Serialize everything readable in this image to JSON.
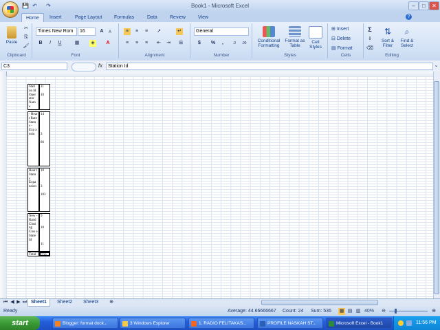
{
  "window": {
    "title": "Book1 - Microsoft Excel",
    "controls": {
      "minimize": "–",
      "maximize": "□",
      "close": "✕"
    },
    "qat": {
      "save": "💾",
      "undo": "↶",
      "redo": "↷"
    }
  },
  "ribbon_tabs": [
    "Home",
    "Insert",
    "Page Layout",
    "Formulas",
    "Data",
    "Review",
    "View"
  ],
  "ribbon": {
    "clipboard": {
      "paste": "Paste",
      "label": "Clipboard"
    },
    "font": {
      "name": "Times New Rom",
      "size": "16",
      "label": "Font",
      "bold": "B",
      "italic": "I",
      "underline": "U",
      "grow": "A",
      "shrink": "A"
    },
    "alignment": {
      "label": "Alignment"
    },
    "number": {
      "format": "General",
      "label": "Number",
      "currency": "$",
      "percent": "%",
      "comma": ","
    },
    "styles": {
      "conditional": "Conditional Formatting",
      "table": "Format as Table",
      "cell": "Cell Styles",
      "label": "Styles"
    },
    "cells": {
      "insert": "Insert",
      "delete": "Delete",
      "format": "Format",
      "label": "Cells"
    },
    "editing": {
      "sum": "Σ",
      "sort": "Sort & Filter",
      "find": "Find & Select",
      "label": "Editing"
    }
  },
  "formula_bar": {
    "name_box": "C3",
    "fx": "fx",
    "content": "Station Id"
  },
  "cells": [
    {
      "text": "Stati on Id Oper ator Nam e",
      "num": "11\n\n10"
    },
    {
      "text": "- Hear t Rate Statu s - Exp a nsio",
      "num": "14\n\n\n\n\n3\n\n86"
    },
    {
      "text": "Hear t Statu s Expa nsion",
      "num": "10\n\n\n\n3\n\n103"
    },
    {
      "text": "New - Rand Closi ng Clos e State Id",
      "num": "9\n\n\n10\n\n\n\n11"
    },
    {
      "text": "Total",
      "num": "536"
    }
  ],
  "sheet_tabs": [
    "Sheet1",
    "Sheet2",
    "Sheet3"
  ],
  "status": {
    "ready": "Ready",
    "average": "Average: 44.66666667",
    "count": "Count: 24",
    "sum": "Sum: 536",
    "zoom": "40%"
  },
  "taskbar": {
    "start": "start",
    "tasks": [
      "Blogger: format dock...",
      "3 Windows Explorer",
      "1. RADIO FELITAKAS...",
      "PROFILE NASKAH ST...",
      "Microsoft Excel - Book1"
    ],
    "clock": "11:56 PM"
  },
  "colors": {
    "ribbon": "#d3e2f5",
    "accent": "#15428b",
    "taskbar": "#245edb",
    "start": "#3a9a35"
  }
}
